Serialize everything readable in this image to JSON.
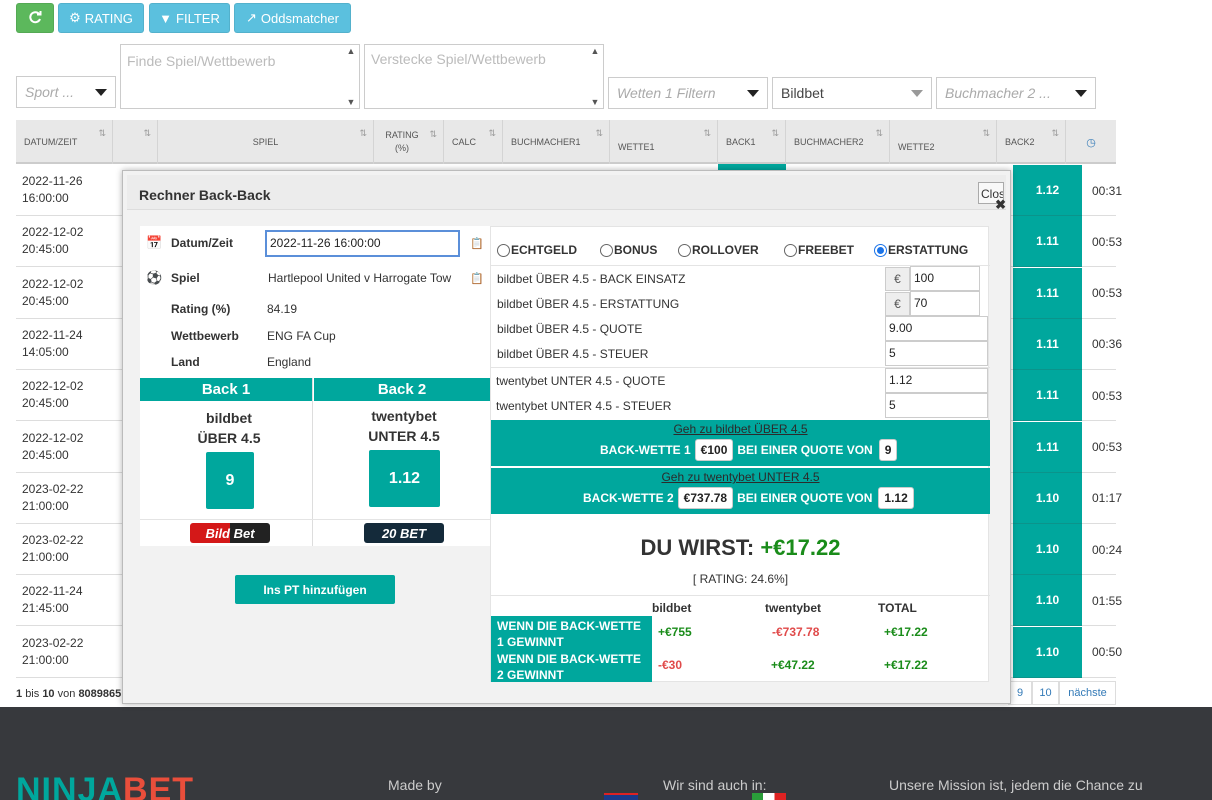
{
  "toolbar": {
    "refresh_icon": "refresh-icon",
    "rating_label": "RATING",
    "filter_label": "FILTER",
    "oddsmatcher_label": "Oddsmatcher"
  },
  "filters": {
    "sport_placeholder": "Sport ...",
    "find_placeholder": "Finde Spiel/Wettbewerb",
    "hide_placeholder": "Verstecke Spiel/Wettbewerb",
    "bets_placeholder": "Wetten 1 Filtern",
    "bookmaker1_value": "Bildbet",
    "bookmaker2_placeholder": "Buchmacher 2 ..."
  },
  "table": {
    "headers": [
      "DATUM/ZEIT",
      "SPIEL",
      "RATING (%)",
      "CALC",
      "BUCHMACHER1",
      "WETTE1",
      "BACK1",
      "BUCHMACHER2",
      "WETTE2",
      "BACK2"
    ],
    "rows": [
      {
        "date": "2022-11-26",
        "time": "16:00:00",
        "back2": "1.12",
        "age": "00:31"
      },
      {
        "date": "2022-12-02",
        "time": "20:45:00",
        "back2": "1.11",
        "age": "00:53"
      },
      {
        "date": "2022-12-02",
        "time": "20:45:00",
        "back2": "1.11",
        "age": "00:53"
      },
      {
        "date": "2022-11-24",
        "time": "14:05:00",
        "back2": "1.11",
        "age": "00:36"
      },
      {
        "date": "2022-12-02",
        "time": "20:45:00",
        "back2": "1.11",
        "age": "00:53"
      },
      {
        "date": "2022-12-02",
        "time": "20:45:00",
        "back2": "1.11",
        "age": "00:53"
      },
      {
        "date": "2023-02-22",
        "time": "21:00:00",
        "back2": "1.10",
        "age": "01:17"
      },
      {
        "date": "2023-02-22",
        "time": "21:00:00",
        "back2": "1.10",
        "age": "00:24"
      },
      {
        "date": "2022-11-24",
        "time": "21:45:00",
        "back2": "1.10",
        "age": "01:55"
      },
      {
        "date": "2023-02-22",
        "time": "21:00:00",
        "back2": "1.10",
        "age": "00:50"
      }
    ]
  },
  "pagination": {
    "from": "1",
    "bis": "bis",
    "to": "10",
    "von": "von",
    "total": "8089865",
    "pages": [
      "9",
      "10"
    ],
    "next_label": "nächste"
  },
  "modal": {
    "title": "Rechner Back-Back",
    "close_label": "Close",
    "datetime_label": "Datum/Zeit",
    "datetime_value": "2022-11-26 16:00:00",
    "match_label": "Spiel",
    "match_value": "Hartlepool United v Harrogate Tow",
    "rating_label": "Rating (%)",
    "rating_value": "84.19",
    "competition_label": "Wettbewerb",
    "competition_value": "ENG FA Cup",
    "country_label": "Land",
    "country_value": "England",
    "back1": {
      "header": "Back 1",
      "bookmaker": "bildbet",
      "bet": "ÜBER 4.5",
      "odds": "9",
      "logo_text": "Bild Bet"
    },
    "back2": {
      "header": "Back 2",
      "bookmaker": "twentybet",
      "bet": "UNTER 4.5",
      "odds": "1.12",
      "logo_text": "20 BET"
    },
    "add_pt_label": "Ins PT hinzufügen",
    "modes": [
      "ECHTGELD",
      "BONUS",
      "ROLLOVER",
      "FREEBET",
      "ERSTATTUNG"
    ],
    "selected_mode": "ERSTATTUNG",
    "fields": {
      "stake_label": "bildbet ÜBER 4.5 - BACK EINSATZ",
      "stake_value": "100",
      "refund_label": "bildbet ÜBER 4.5 - ERSTATTUNG",
      "refund_value": "70",
      "odds1_label": "bildbet ÜBER 4.5 - QUOTE",
      "odds1_value": "9.00",
      "tax1_label": "bildbet ÜBER 4.5 - STEUER",
      "tax1_value": "5",
      "odds2_label": "twentybet UNTER 4.5  - QUOTE",
      "odds2_value": "1.12",
      "tax2_label": "twentybet UNTER 4.5 - STEUER",
      "tax2_value": "5",
      "currency": "€"
    },
    "instr1": {
      "link": "Geh zu bildbet ÜBER 4.5",
      "prefix": "BACK-WETTE 1",
      "stake": "€100",
      "mid": "BEI EINER QUOTE VON",
      "odds": "9"
    },
    "instr2": {
      "link": "Geh zu twentybet UNTER 4.5",
      "prefix": "BACK-WETTE 2",
      "stake": "€737.78",
      "mid": "BEI EINER QUOTE VON",
      "odds": "1.12"
    },
    "result_label": "DU WIRST:",
    "result_value": "+€17.22",
    "rating_text": "[ RATING: 24.6%]",
    "summary": {
      "col1": "bildbet",
      "col2": "twentybet",
      "col3": "TOTAL",
      "row1_label": "WENN DIE BACK-WETTE 1 GEWINNT",
      "row1": [
        "+€755",
        "-€737.78",
        "+€17.22"
      ],
      "row2_label": "WENN DIE BACK-WETTE 2 GEWINNT",
      "row2": [
        "-€30",
        "+€47.22",
        "+€17.22"
      ]
    }
  },
  "footer": {
    "logo_a": "NINJA",
    "logo_b": "BET",
    "made_by": "Made by",
    "also_in": "Wir sind auch in:",
    "mission": "Unsere Mission ist, jedem die Chance zu"
  },
  "colors": {
    "accent": "#00a79d",
    "green_btn": "#5cb85c",
    "blue_btn": "#5bc0de",
    "footer": "#37393d"
  }
}
